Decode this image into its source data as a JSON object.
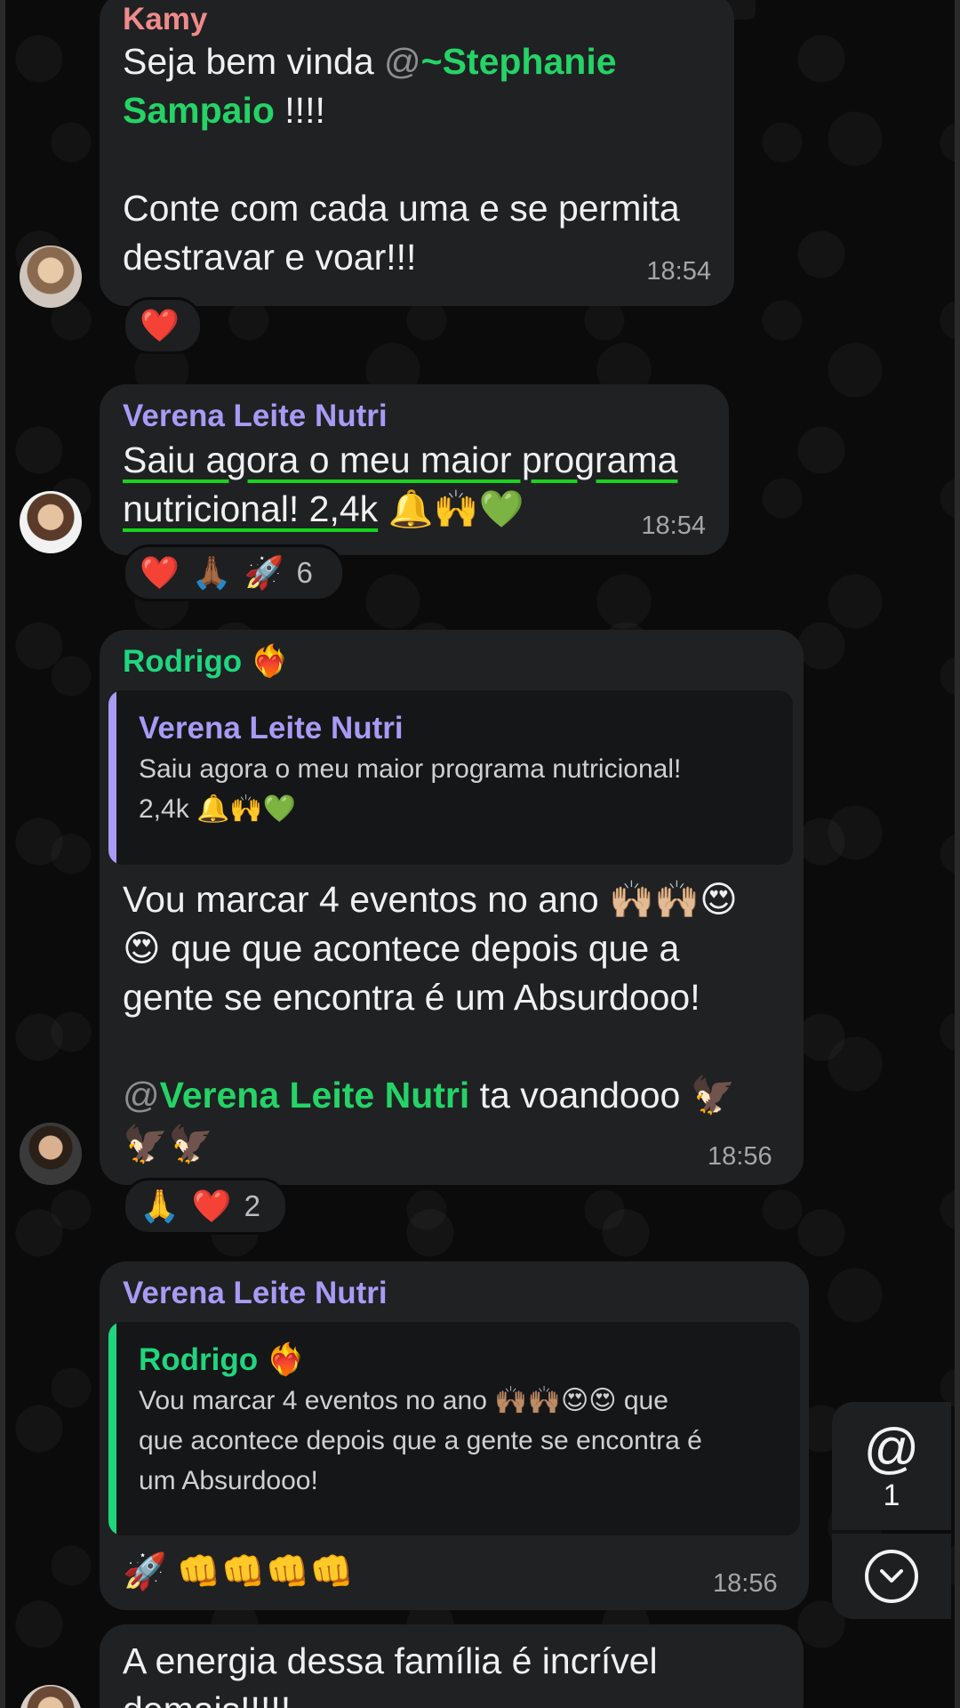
{
  "messages": [
    {
      "sender": "Kamy",
      "greeting_prefix": "Seja bem vinda ",
      "mention_at": "@",
      "mention_name_1": "~Stephanie",
      "mention_name_2": "Sampaio",
      "greeting_suffix": " !!!!",
      "line_3": "Conte com cada uma e se permita",
      "line_4": "destravar e voar!!!",
      "time": "18:54",
      "reactions": [
        "❤️"
      ]
    },
    {
      "sender": "Verena Leite Nutri",
      "line_1": "Saiu agora o meu maior programa",
      "line_2_text": "nutricional! 2,4k",
      "line_2_emoji": " 🔔🙌💚",
      "time": "18:54",
      "reactions": [
        "❤️",
        "🙏🏾",
        "🚀"
      ],
      "reaction_count": "6"
    },
    {
      "sender": "Rodrigo",
      "sender_emoji": "❤️‍🔥",
      "quote": {
        "name": "Verena Leite Nutri",
        "line_1": "Saiu agora o meu maior programa nutricional!",
        "line_2": "2,4k 🔔🙌💚"
      },
      "line_1": "Vou marcar 4 eventos no ano 🙌🏼🙌🏼😍",
      "line_2": "😍 que que acontece depois que a",
      "line_3": "gente se encontra é um Absurdooo!",
      "mention_at": "@",
      "mention_name": "Verena Leite Nutri",
      "mention_suffix": " ta voandooo 🦅",
      "line_5": "🦅🦅",
      "time": "18:56",
      "reactions": [
        "🙏",
        "❤️"
      ],
      "reaction_count": "2"
    },
    {
      "sender": "Verena Leite Nutri",
      "quote": {
        "name": "Rodrigo",
        "name_emoji": "❤️‍🔥",
        "line_1": "Vou marcar 4 eventos no ano 🙌🏽🙌🏽😍😍 que",
        "line_2": "que acontece depois que a gente se encontra é",
        "line_3": "um Absurdooo!"
      },
      "body": "🚀 👊👊👊👊",
      "time": "18:56"
    },
    {
      "line_1": "A energia dessa família é incrível",
      "line_2": "demais!!!!!"
    }
  ],
  "side_buttons": {
    "mention_symbol": "@",
    "mention_count": "1",
    "scroll_down_icon": "chevron-down-circle-icon"
  },
  "colors": {
    "kamy": "#f08a8a",
    "verena": "#a99af5",
    "rodrigo": "#1fd67f",
    "mention": "#25d366",
    "bubble": "#1f2123"
  }
}
